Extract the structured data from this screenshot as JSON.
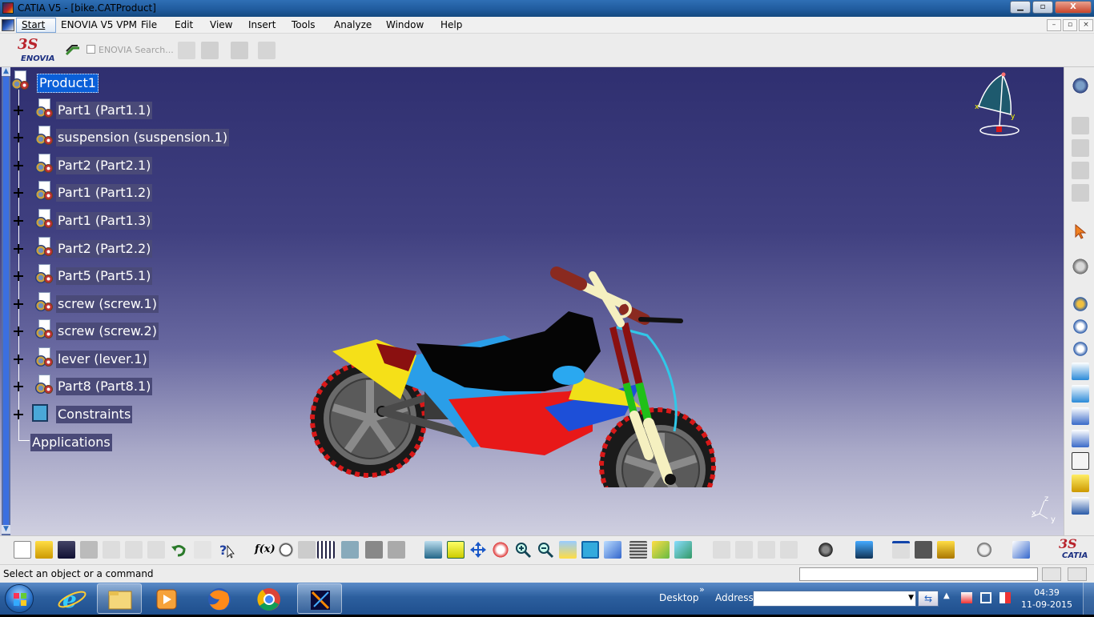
{
  "window": {
    "title": "CATIA V5 - [bike.CATProduct]",
    "buttons": {
      "minimize": "▁",
      "maximize": "▫",
      "close": "X"
    }
  },
  "menu": {
    "items": [
      "Start",
      "ENOVIA V5 VPM",
      "File",
      "Edit",
      "View",
      "Insert",
      "Tools",
      "Analyze",
      "Window",
      "Help"
    ],
    "mdi_buttons": [
      "–",
      "▫",
      "×"
    ]
  },
  "top_toolbar": {
    "logo_mark": "3S",
    "logo_text": "ENOVIA",
    "search_label": "ENOVIA Search..."
  },
  "tree": {
    "root": "Product1",
    "nodes": [
      "Part1 (Part1.1)",
      "suspension (suspension.1)",
      "Part2 (Part2.1)",
      "Part1 (Part1.2)",
      "Part1 (Part1.3)",
      "Part2 (Part2.2)",
      "Part5 (Part5.1)",
      "screw (screw.1)",
      "screw (screw.2)",
      "lever (lever.1)",
      "Part8 (Part8.1)"
    ],
    "constraints": "Constraints",
    "applications": "Applications"
  },
  "axis": {
    "z": "z",
    "x": "x",
    "y": "y"
  },
  "bottom_toolbar": {
    "formula_label": "f(x)",
    "catia_logo_mark": "3S",
    "catia_logo_text": "CATIA"
  },
  "status": {
    "message": "Select an object or a command"
  },
  "taskbar": {
    "desktop_label": "Desktop",
    "address_label": "Address",
    "time": "04:39",
    "date": "11-09-2015",
    "chevron": "»"
  },
  "colors": {
    "viewport_top": "#2f2f70",
    "viewport_bottom": "#cfcfe0",
    "selection": "#0a5fd8",
    "tree_label_bg": "#4a4a78"
  }
}
